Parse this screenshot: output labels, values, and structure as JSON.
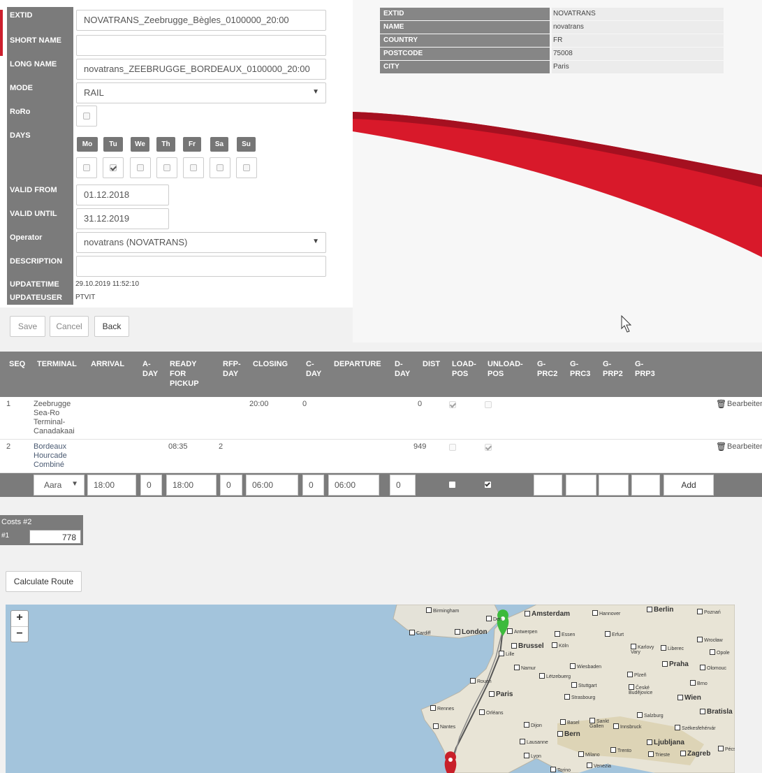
{
  "form": {
    "labels": {
      "extid": "EXTID",
      "short_name": "SHORT NAME",
      "long_name": "LONG NAME",
      "mode": "MODE",
      "roro": "RoRo",
      "days": "DAYS",
      "valid_from": "VALID FROM",
      "valid_until": "VALID UNTIL",
      "operator": "Operator",
      "description": "DESCRIPTION",
      "updatetime": "UPDATETIME",
      "updateuser": "UPDATEUSER"
    },
    "values": {
      "extid": "NOVATRANS_Zeebrugge_Bègles_0100000_20:00",
      "short_name": "",
      "long_name": "novatrans_ZEEBRUGGE_BORDEAUX_0100000_20:00",
      "mode": "RAIL",
      "valid_from": "01.12.2018",
      "valid_until": "31.12.2019",
      "operator": "novatrans (NOVATRANS)",
      "description": "",
      "updatetime": "29.10.2019 11:52:10",
      "updateuser": "PTVIT"
    },
    "days": [
      {
        "label": "Mo",
        "checked": false
      },
      {
        "label": "Tu",
        "checked": true
      },
      {
        "label": "We",
        "checked": false
      },
      {
        "label": "Th",
        "checked": false
      },
      {
        "label": "Fr",
        "checked": false
      },
      {
        "label": "Sa",
        "checked": false
      },
      {
        "label": "Su",
        "checked": false
      }
    ],
    "roro_checked": false,
    "buttons": {
      "save": "Save",
      "cancel": "Cancel",
      "back": "Back"
    }
  },
  "operator_info": [
    {
      "key": "EXTID",
      "value": "NOVATRANS"
    },
    {
      "key": "NAME",
      "value": "novatrans"
    },
    {
      "key": "COUNTRY",
      "value": "FR"
    },
    {
      "key": "POSTCODE",
      "value": "75008"
    },
    {
      "key": "CITY",
      "value": "Paris"
    }
  ],
  "schedule": {
    "headers": {
      "seq": "SEQ",
      "terminal": "TERMINAL",
      "arrival": "ARRIVAL",
      "a_day": "A-\nDAY",
      "ready": "READY\nFOR\nPICKUP",
      "rfp_day": "RFP-\nDAY",
      "closing": "CLOSING",
      "c_day": "C-\nDAY",
      "departure": "DEPARTURE",
      "d_day": "D-\nDAY",
      "dist": "DIST",
      "load_pos": "LOAD-\nPOS",
      "unload_pos": "UNLOAD-\nPOS",
      "g_prc2": "G-\nPRC2",
      "g_prc3": "G-\nPRC3",
      "g_prp2": "G-\nPRP2",
      "g_prp3": "G-\nPRP3"
    },
    "rows": [
      {
        "seq": "1",
        "terminal": "Zeebrugge\nSea-Ro\nTerminal-\nCanadakaai",
        "arrival": "",
        "ready": "",
        "rfp_day": "",
        "closing": "20:00",
        "c_day": "0",
        "dist": "0",
        "load": true,
        "unload": false,
        "edit": "Bearbeiten"
      },
      {
        "seq": "2",
        "terminal": "Bordeaux\nHourcade\nCombiné",
        "arrival": "",
        "ready": "08:35",
        "rfp_day": "2",
        "closing": "",
        "c_day": "",
        "dist": "949",
        "load": false,
        "unload": true,
        "edit": "Bearbeiten"
      }
    ],
    "new_row": {
      "terminal": "Aara",
      "arrival": "18:00",
      "a_day": "0",
      "ready": "18:00",
      "rfp_day": "0",
      "closing": "06:00",
      "c_day": "0",
      "departure": "06:00",
      "d_day": "0",
      "load": false,
      "unload": true,
      "add_label": "Add"
    }
  },
  "costs": {
    "title": "Costs #2",
    "row_label": "#1",
    "value": "778"
  },
  "calculate_route": "Calculate Route",
  "map": {
    "zoom_in": "+",
    "zoom_out": "−",
    "cities": {
      "birmingham": "Birmingham",
      "cardiff": "Cardiff",
      "london": "London",
      "amsterdam": "Amsterdam",
      "hannover": "Hannover",
      "berlin": "Berlin",
      "poznan": "Poznań",
      "antwerpen": "Antwerpen",
      "essen": "Essen",
      "erfurt": "Erfurt",
      "wroclaw": "Wrocław",
      "brussel": "Brussel",
      "koln": "Köln",
      "lille": "Lille",
      "karlovy": "Karlovy\nVary",
      "liberec": "Liberec",
      "opole": "Opole",
      "namur": "Namur",
      "wiesbaden": "Wiesbaden",
      "praha": "Praha",
      "olomouc": "Olomouc",
      "rouen": "Rouen",
      "luxembourg": "Lëtzebuerg",
      "plzen": "Plzeň",
      "stuttgart": "Stuttgart",
      "paris": "Paris",
      "budejovice": "České\nBudějovice",
      "brno": "Brno",
      "wien": "Wien",
      "strasbourg": "Strasbourg",
      "rennes": "Rennes",
      "orleans": "Orléans",
      "bratislava": "Bratisla",
      "salzburg": "Salzburg",
      "nantes": "Nantes",
      "dijon": "Dijon",
      "basel": "Basel",
      "sankt_gallen": "Sankt\nGallen",
      "innsbruck": "Innsbruck",
      "szekesfehervar": "Székesfehérvár",
      "bern": "Bern",
      "lausanne": "Lausanne",
      "ljubljana": "Ljubljana",
      "lyon": "Lyon",
      "milano": "Milano",
      "trento": "Trento",
      "trieste": "Trieste",
      "zagreb": "Zagreb",
      "venezia": "Venezia",
      "torino": "Torino",
      "pecs": "Pécs",
      "den_haag": "Den"
    },
    "colors": {
      "water": "#a3c4dc",
      "land": "#e8e4dc",
      "route": "#555555",
      "start_pin": "#3cba3c",
      "end_pin": "#c8202a"
    }
  }
}
